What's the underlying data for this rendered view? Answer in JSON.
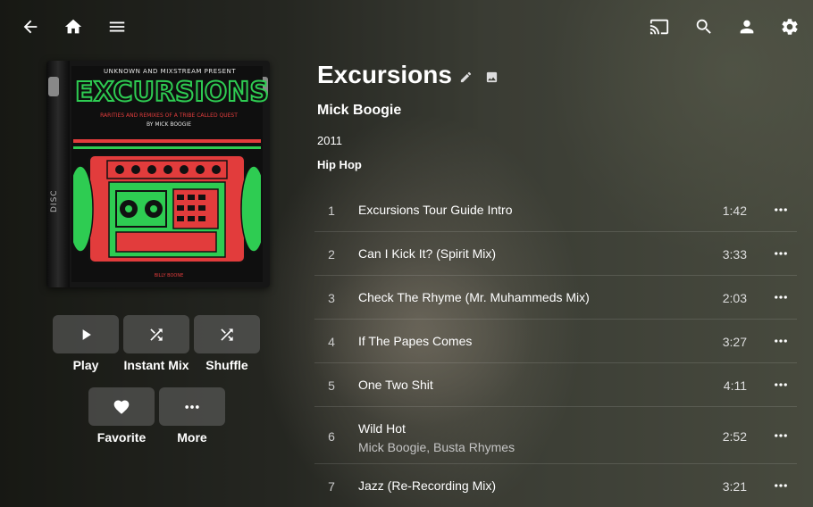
{
  "topbar": {
    "back_icon": "arrow-left-icon",
    "home_icon": "home-icon",
    "menu_icon": "hamburger-menu-icon",
    "cast_icon": "cast-icon",
    "search_icon": "search-icon",
    "user_icon": "user-icon",
    "settings_icon": "gear-icon"
  },
  "album": {
    "title": "Excursions",
    "artist": "Mick Boogie",
    "year": "2011",
    "genre": "Hip Hop",
    "cover": {
      "presenter": "UNKNOWN AND MIXSTREAM PRESENT",
      "big_title": "EXCURSIONS",
      "subtitle": "RARITIES AND REMIXES OF A TRIBE CALLED QUEST",
      "by": "BY MICK BOOGIE",
      "spine_text": "DISC",
      "footer": "BILLY BOONE"
    }
  },
  "actions": [
    {
      "label": "Play",
      "icon": "play-icon"
    },
    {
      "label": "Instant Mix",
      "icon": "shuffle-icon"
    },
    {
      "label": "Shuffle",
      "icon": "shuffle-icon"
    },
    {
      "label": "Favorite",
      "icon": "heart-icon"
    },
    {
      "label": "More",
      "icon": "more-horizontal-icon"
    }
  ],
  "tracks": [
    {
      "num": "1",
      "name": "Excursions Tour Guide Intro",
      "duration": "1:42"
    },
    {
      "num": "2",
      "name": "Can I Kick It? (Spirit Mix)",
      "duration": "3:33"
    },
    {
      "num": "3",
      "name": "Check The Rhyme (Mr. Muhammeds Mix)",
      "duration": "2:03"
    },
    {
      "num": "4",
      "name": "If The Papes Comes",
      "duration": "3:27"
    },
    {
      "num": "5",
      "name": "One Two Shit",
      "duration": "4:11"
    },
    {
      "num": "6",
      "name": "Wild Hot",
      "artists": "Mick Boogie, Busta Rhymes",
      "duration": "2:52"
    },
    {
      "num": "7",
      "name": "Jazz (Re-Recording Mix)",
      "duration": "3:21"
    }
  ],
  "colors": {
    "accent_green": "#2ecc52",
    "accent_red": "#e23c3c",
    "button_bg": "rgba(120,120,120,0.45)"
  }
}
